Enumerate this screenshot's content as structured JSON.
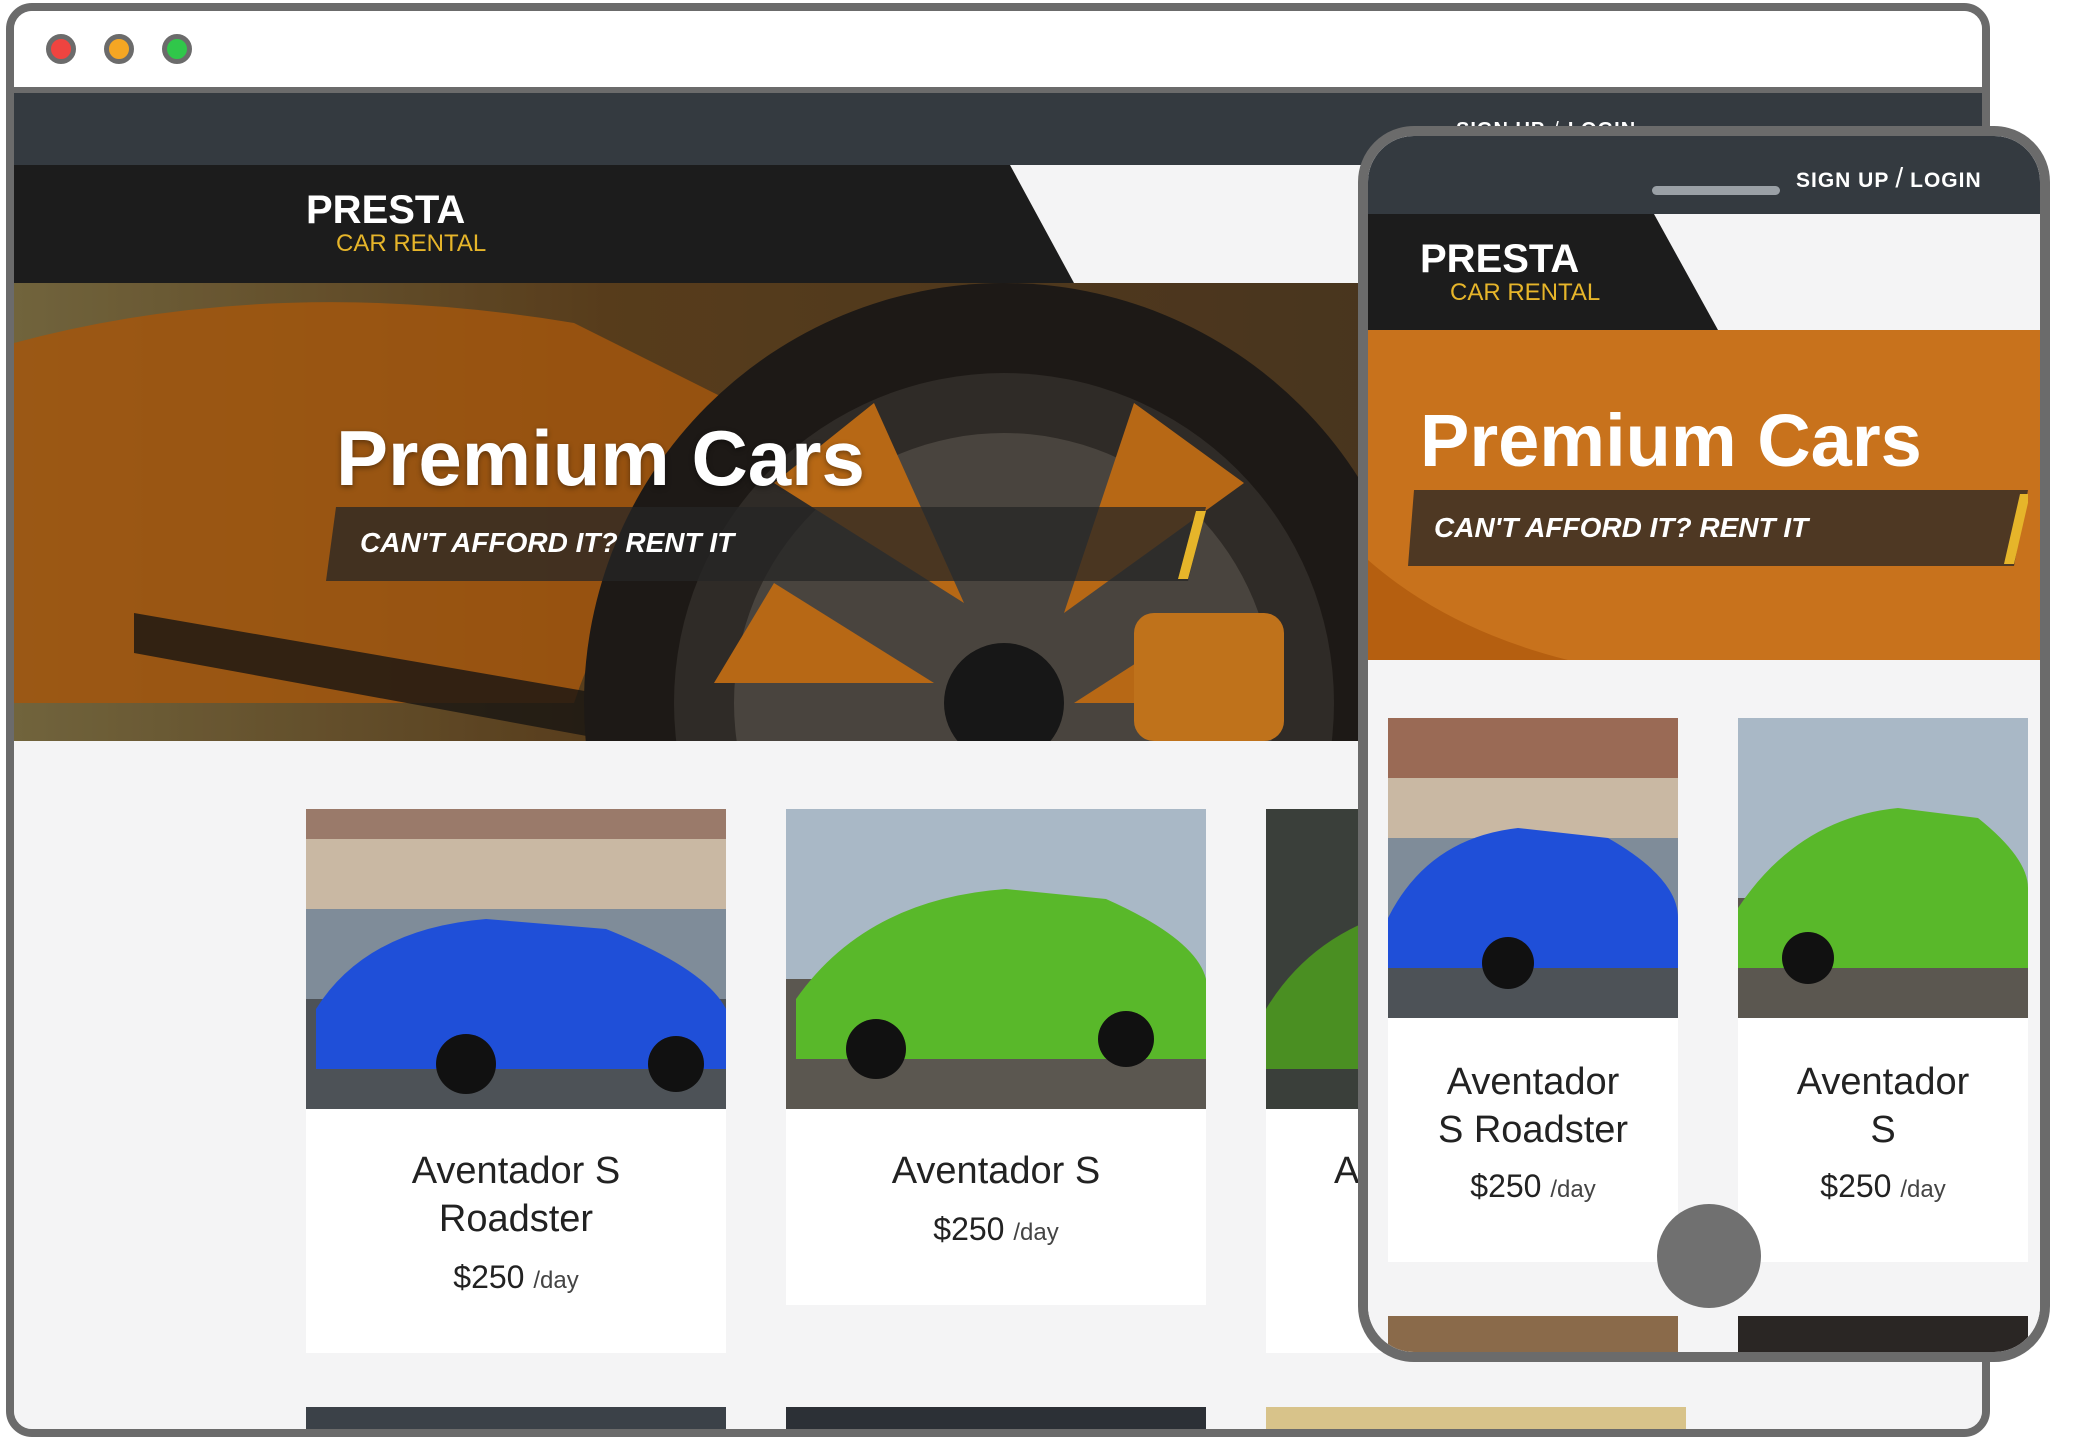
{
  "desktop": {
    "nav": {
      "signup": "SIGN UP",
      "separator": "/",
      "login": "LOGIN"
    },
    "brand": {
      "name": "PRESTA",
      "tagline": "CAR RENTAL"
    },
    "hero": {
      "title": "Premium Cars",
      "tagline": "CAN'T AFFORD IT? RENT IT"
    },
    "cars": [
      {
        "name": "Aventador S Roadster",
        "price": "$250",
        "unit": "/day",
        "color": "#1f4fd8"
      },
      {
        "name": "Aventador S",
        "price": "$250",
        "unit": "/day",
        "color": "#59b82a"
      },
      {
        "name": "A",
        "price": "",
        "unit": "",
        "color": "#4a8f22"
      }
    ]
  },
  "mobile": {
    "nav": {
      "signup": "SIGN UP",
      "separator": "/",
      "login": "LOGIN"
    },
    "brand": {
      "name": "PRESTA",
      "tagline": "CAR RENTAL"
    },
    "hero": {
      "title": "Premium Cars",
      "tagline": "CAN'T AFFORD IT? RENT IT"
    },
    "cars": [
      {
        "name_line1": "Aventador",
        "name_line2": "S Roadster",
        "price": "$250",
        "unit": "/day",
        "color": "#1f4fd8"
      },
      {
        "name_line1": "Aventador",
        "name_line2": "S",
        "price": "$250",
        "unit": "/day",
        "color": "#59b82a"
      }
    ]
  },
  "colors": {
    "dark": "#1c1c1c",
    "topbar": "#343a40",
    "accent": "#e6b52a",
    "hero_orange": "#c8721c",
    "frame": "#6b6b6b"
  }
}
